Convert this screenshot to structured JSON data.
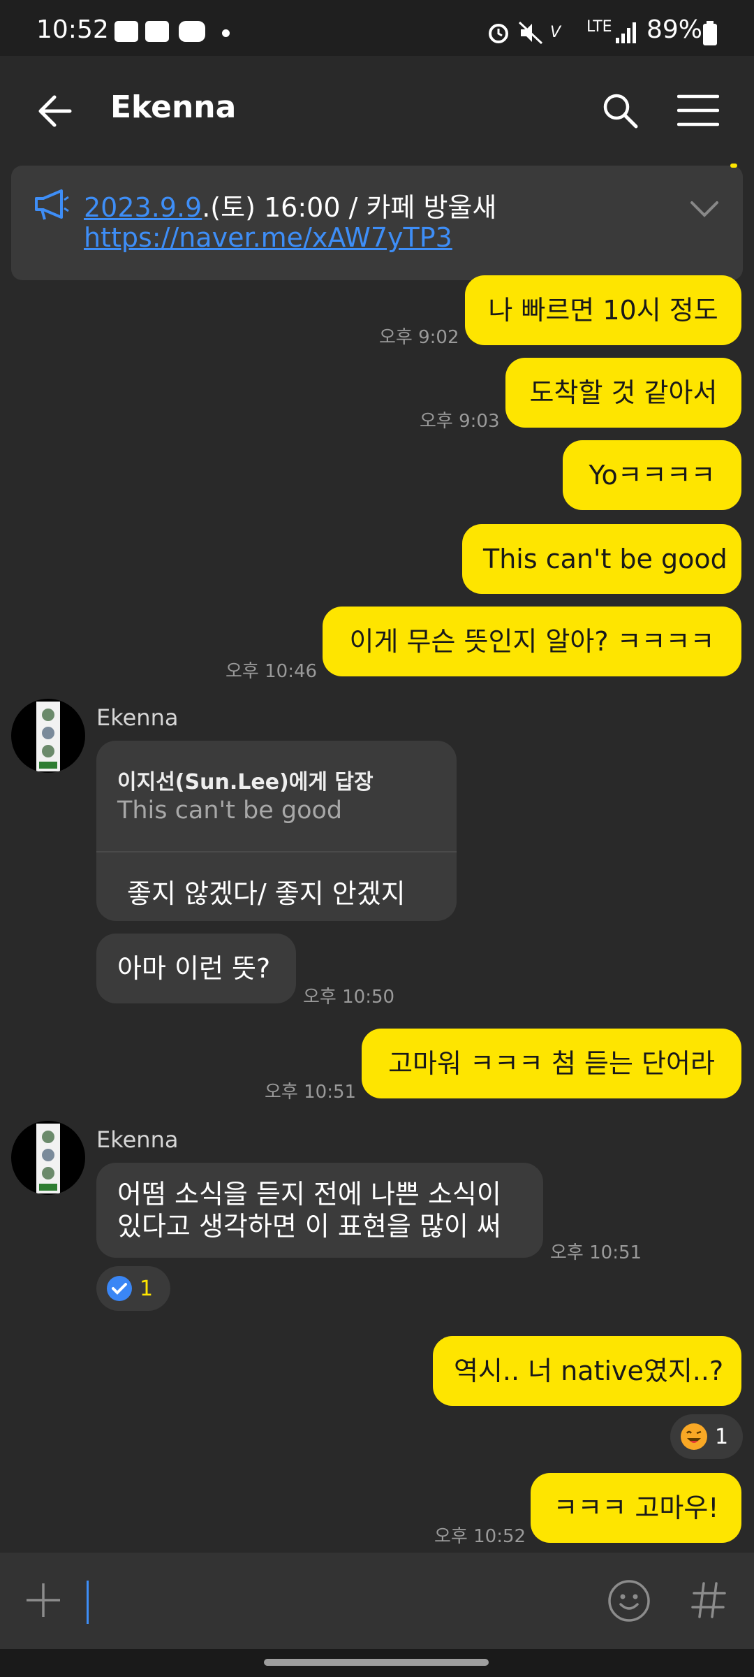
{
  "status_bar": {
    "time": "10:52",
    "battery": "89%",
    "network": "LTE"
  },
  "header": {
    "title": "Ekenna"
  },
  "notice": {
    "date_link": "2023.9.9",
    "text": ".(토) 16:00 / 카페 방울새",
    "url": "https://naver.me/xAW7yTP3"
  },
  "messages": [
    {
      "text": "나 빠르면 10시 정도",
      "time": "오후 9:02"
    },
    {
      "text": "도착할 것 같아서",
      "time": "오후 9:03"
    },
    {
      "text": "Yoㅋㅋㅋㅋ"
    },
    {
      "text": "This can't be good"
    },
    {
      "text": "이게 무슨 뜻인지 알아? ㅋㅋㅋㅋ",
      "time": "오후 10:46"
    },
    {
      "sender": "Ekenna",
      "reply_to": "이지선(Sun.Lee)에게 답장",
      "reply_quote": "This can't be good",
      "text": "좋지 않겠다/ 좋지 안겠지"
    },
    {
      "text": "아마 이런 뜻?",
      "time": "오후 10:50"
    },
    {
      "text": "고마워 ㅋㅋㅋ 첨 듣는 단어라",
      "time": "오후 10:51"
    },
    {
      "sender": "Ekenna",
      "line1": "어떰 소식을 듣지 전에 나쁜 소식이",
      "line2": "있다고 생각하면 이 표현을 많이 써",
      "time": "오후 10:51",
      "reaction_count": "1"
    },
    {
      "text": "역시.. 너 native였지..?",
      "reaction_count": "1"
    },
    {
      "text": "ㅋㅋㅋ 고마우!",
      "time": "오후 10:52"
    }
  ],
  "colors": {
    "outgoing": "#fee500",
    "incoming": "#3b3b3b",
    "background": "#292929",
    "link": "#3e8ef7"
  },
  "icons": [
    "back-arrow-icon",
    "search-icon",
    "menu-icon",
    "megaphone-icon",
    "chevron-down-icon",
    "plus-icon",
    "emoji-icon",
    "hashtag-icon"
  ]
}
